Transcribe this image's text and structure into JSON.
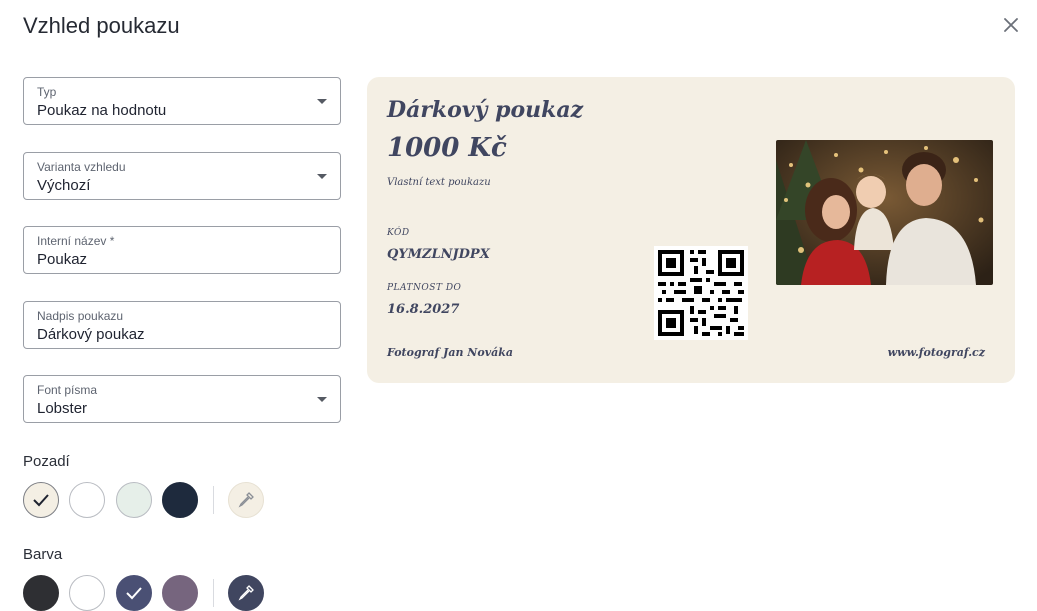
{
  "dialog": {
    "title": "Vzhled poukazu"
  },
  "form": {
    "type": {
      "label": "Typ",
      "value": "Poukaz na hodnotu"
    },
    "variant": {
      "label": "Varianta vzhledu",
      "value": "Výchozí"
    },
    "internal_name": {
      "label": "Interní název *",
      "value": "Poukaz"
    },
    "heading": {
      "label": "Nadpis poukazu",
      "value": "Dárkový poukaz"
    },
    "font": {
      "label": "Font písma",
      "value": "Lobster"
    }
  },
  "background": {
    "label": "Pozadí",
    "swatches": [
      {
        "color": "#f4efe4",
        "selected": true
      },
      {
        "color": "#ffffff",
        "selected": false
      },
      {
        "color": "#e6efe9",
        "selected": false
      },
      {
        "color": "#1e2a3d",
        "selected": false
      }
    ],
    "custom_color": "#f4efe4"
  },
  "text_color": {
    "label": "Barva",
    "swatches": [
      {
        "color": "#2e2f33",
        "selected": false
      },
      {
        "color": "#ffffff",
        "selected": false
      },
      {
        "color": "#4a5074",
        "selected": true
      },
      {
        "color": "#76657e",
        "selected": false
      }
    ],
    "custom_color": "#404660"
  },
  "voucher_preview": {
    "heading": "Dárkový poukaz",
    "amount": "1000 Kč",
    "custom_text": "Vlastní text poukazu",
    "code_label": "KÓD",
    "code": "QYMZLNJDPX",
    "validity_label": "PLATNOST DO",
    "validity": "16.8.2027",
    "issuer": "Fotograf Jan Nováka",
    "website": "www.fotograf.cz",
    "text_color": "#404660",
    "background_color": "#f4efe4"
  }
}
